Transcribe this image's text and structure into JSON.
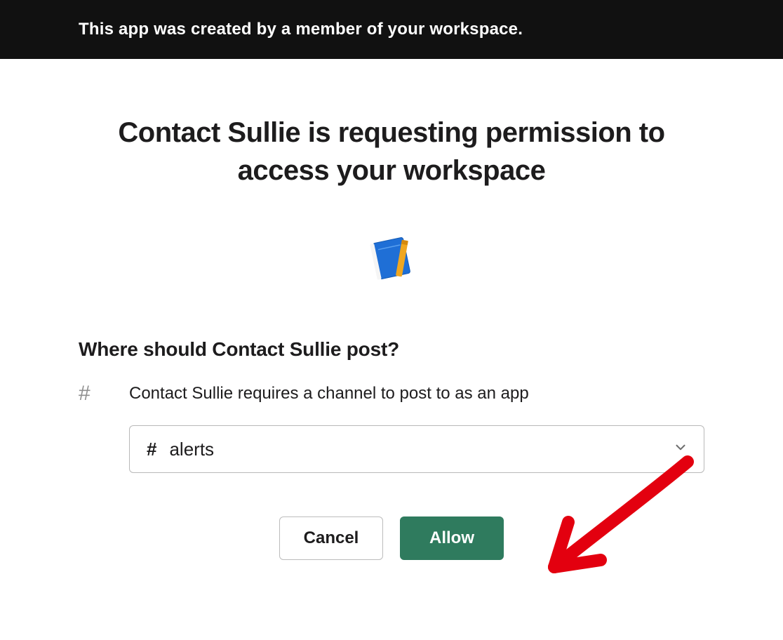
{
  "banner": {
    "text": "This app was created by a member of your workspace."
  },
  "headline": "Contact Sullie is requesting permission to access your workspace",
  "app": {
    "name": "Contact Sullie",
    "icon_name": "app-icon"
  },
  "question": "Where should Contact Sullie post?",
  "channel_section": {
    "hash_glyph": "#",
    "description": "Contact Sullie requires a channel to post to as an app",
    "selected_channel": "alerts"
  },
  "buttons": {
    "cancel": "Cancel",
    "allow": "Allow"
  },
  "colors": {
    "banner_bg": "#111111",
    "allow_bg": "#2f7b5e",
    "annotation": "#e3000f"
  }
}
